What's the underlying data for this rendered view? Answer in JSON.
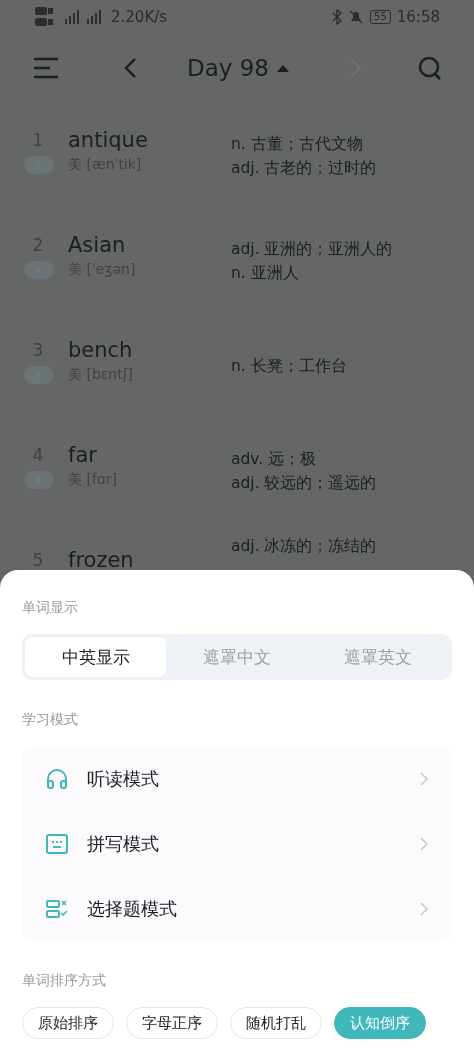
{
  "status_bar": {
    "speed": "2.20K/s",
    "battery": "55",
    "time": "16:58"
  },
  "nav": {
    "title": "Day 98"
  },
  "words": [
    {
      "index": "1",
      "word": "antique",
      "phonetic": "美 [ænˈtik]",
      "meanings": [
        "n. 古董；古代文物",
        "adj. 古老的；过时的"
      ]
    },
    {
      "index": "2",
      "word": "Asian",
      "phonetic": "美 [ˈeʒən]",
      "meanings": [
        "adj. 亚洲的；亚洲人的",
        "n. 亚洲人"
      ]
    },
    {
      "index": "3",
      "word": "bench",
      "phonetic": "美 [bɛntʃ]",
      "meanings": [
        "n. 长凳；工作台"
      ]
    },
    {
      "index": "4",
      "word": "far",
      "phonetic": "美 [fɑr]",
      "meanings": [
        "adv. 远；极",
        "adj. 较远的；遥远的"
      ]
    },
    {
      "index": "5",
      "word": "frozen",
      "meanings": [
        "adj. 冰冻的；冻结的"
      ]
    }
  ],
  "sheet": {
    "display_label": "单词显示",
    "display_tabs": [
      {
        "label": "中英显示",
        "selected": true
      },
      {
        "label": "遮罩中文",
        "selected": false
      },
      {
        "label": "遮罩英文",
        "selected": false
      }
    ],
    "mode_label": "学习模式",
    "modes": [
      {
        "label": "听读模式",
        "kind": "listen"
      },
      {
        "label": "拼写模式",
        "kind": "spell"
      },
      {
        "label": "选择题模式",
        "kind": "choice"
      }
    ],
    "order_label": "单词排序方式",
    "order_options": [
      {
        "label": "原始排序",
        "selected": false
      },
      {
        "label": "字母正序",
        "selected": false
      },
      {
        "label": "随机打乱",
        "selected": false
      },
      {
        "label": "认知倒序",
        "selected": true
      }
    ]
  }
}
